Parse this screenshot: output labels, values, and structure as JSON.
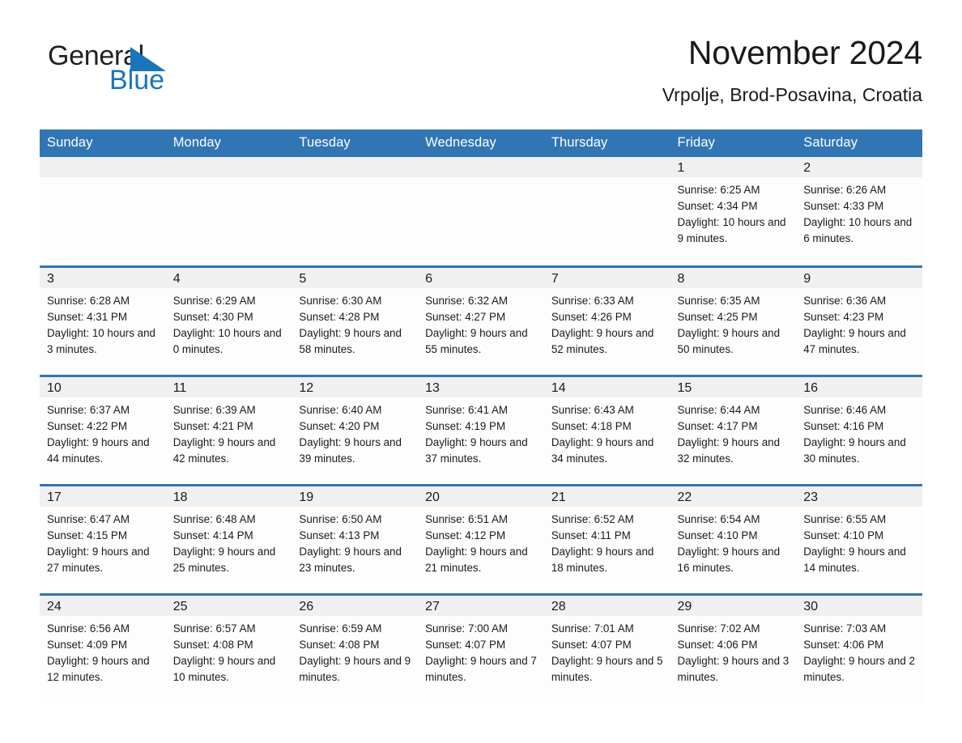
{
  "brand": {
    "line1": "General",
    "line2": "Blue",
    "triangle_color": "#1b75bb",
    "text_color": "#231f20"
  },
  "header": {
    "title": "November 2024",
    "subtitle": "Vrpolje, Brod-Posavina, Croatia"
  },
  "theme": {
    "header_blue": "#3275b5",
    "daynum_band": "#f0f0f0",
    "cell_bg": "#fdfdfd",
    "text": "#1a1a1a"
  },
  "labels": {
    "sunrise_prefix": "Sunrise:",
    "sunset_prefix": "Sunset:",
    "daylight_prefix": "Daylight:"
  },
  "weekday_headers": [
    "Sunday",
    "Monday",
    "Tuesday",
    "Wednesday",
    "Thursday",
    "Friday",
    "Saturday"
  ],
  "chart_data": {
    "type": "table",
    "title": "November 2024",
    "subtitle": "Vrpolje, Brod-Posavina, Croatia",
    "columns": [
      "Sunday",
      "Monday",
      "Tuesday",
      "Wednesday",
      "Thursday",
      "Friday",
      "Saturday"
    ],
    "days": [
      {
        "day": 1,
        "weekday": "Friday",
        "sunrise": "6:25 AM",
        "sunset": "4:34 PM",
        "daylight_hours": 10,
        "daylight_minutes": 9
      },
      {
        "day": 2,
        "weekday": "Saturday",
        "sunrise": "6:26 AM",
        "sunset": "4:33 PM",
        "daylight_hours": 10,
        "daylight_minutes": 6
      },
      {
        "day": 3,
        "weekday": "Sunday",
        "sunrise": "6:28 AM",
        "sunset": "4:31 PM",
        "daylight_hours": 10,
        "daylight_minutes": 3
      },
      {
        "day": 4,
        "weekday": "Monday",
        "sunrise": "6:29 AM",
        "sunset": "4:30 PM",
        "daylight_hours": 10,
        "daylight_minutes": 0
      },
      {
        "day": 5,
        "weekday": "Tuesday",
        "sunrise": "6:30 AM",
        "sunset": "4:28 PM",
        "daylight_hours": 9,
        "daylight_minutes": 58
      },
      {
        "day": 6,
        "weekday": "Wednesday",
        "sunrise": "6:32 AM",
        "sunset": "4:27 PM",
        "daylight_hours": 9,
        "daylight_minutes": 55
      },
      {
        "day": 7,
        "weekday": "Thursday",
        "sunrise": "6:33 AM",
        "sunset": "4:26 PM",
        "daylight_hours": 9,
        "daylight_minutes": 52
      },
      {
        "day": 8,
        "weekday": "Friday",
        "sunrise": "6:35 AM",
        "sunset": "4:25 PM",
        "daylight_hours": 9,
        "daylight_minutes": 50
      },
      {
        "day": 9,
        "weekday": "Saturday",
        "sunrise": "6:36 AM",
        "sunset": "4:23 PM",
        "daylight_hours": 9,
        "daylight_minutes": 47
      },
      {
        "day": 10,
        "weekday": "Sunday",
        "sunrise": "6:37 AM",
        "sunset": "4:22 PM",
        "daylight_hours": 9,
        "daylight_minutes": 44
      },
      {
        "day": 11,
        "weekday": "Monday",
        "sunrise": "6:39 AM",
        "sunset": "4:21 PM",
        "daylight_hours": 9,
        "daylight_minutes": 42
      },
      {
        "day": 12,
        "weekday": "Tuesday",
        "sunrise": "6:40 AM",
        "sunset": "4:20 PM",
        "daylight_hours": 9,
        "daylight_minutes": 39
      },
      {
        "day": 13,
        "weekday": "Wednesday",
        "sunrise": "6:41 AM",
        "sunset": "4:19 PM",
        "daylight_hours": 9,
        "daylight_minutes": 37
      },
      {
        "day": 14,
        "weekday": "Thursday",
        "sunrise": "6:43 AM",
        "sunset": "4:18 PM",
        "daylight_hours": 9,
        "daylight_minutes": 34
      },
      {
        "day": 15,
        "weekday": "Friday",
        "sunrise": "6:44 AM",
        "sunset": "4:17 PM",
        "daylight_hours": 9,
        "daylight_minutes": 32
      },
      {
        "day": 16,
        "weekday": "Saturday",
        "sunrise": "6:46 AM",
        "sunset": "4:16 PM",
        "daylight_hours": 9,
        "daylight_minutes": 30
      },
      {
        "day": 17,
        "weekday": "Sunday",
        "sunrise": "6:47 AM",
        "sunset": "4:15 PM",
        "daylight_hours": 9,
        "daylight_minutes": 27
      },
      {
        "day": 18,
        "weekday": "Monday",
        "sunrise": "6:48 AM",
        "sunset": "4:14 PM",
        "daylight_hours": 9,
        "daylight_minutes": 25
      },
      {
        "day": 19,
        "weekday": "Tuesday",
        "sunrise": "6:50 AM",
        "sunset": "4:13 PM",
        "daylight_hours": 9,
        "daylight_minutes": 23
      },
      {
        "day": 20,
        "weekday": "Wednesday",
        "sunrise": "6:51 AM",
        "sunset": "4:12 PM",
        "daylight_hours": 9,
        "daylight_minutes": 21
      },
      {
        "day": 21,
        "weekday": "Thursday",
        "sunrise": "6:52 AM",
        "sunset": "4:11 PM",
        "daylight_hours": 9,
        "daylight_minutes": 18
      },
      {
        "day": 22,
        "weekday": "Friday",
        "sunrise": "6:54 AM",
        "sunset": "4:10 PM",
        "daylight_hours": 9,
        "daylight_minutes": 16
      },
      {
        "day": 23,
        "weekday": "Saturday",
        "sunrise": "6:55 AM",
        "sunset": "4:10 PM",
        "daylight_hours": 9,
        "daylight_minutes": 14
      },
      {
        "day": 24,
        "weekday": "Sunday",
        "sunrise": "6:56 AM",
        "sunset": "4:09 PM",
        "daylight_hours": 9,
        "daylight_minutes": 12
      },
      {
        "day": 25,
        "weekday": "Monday",
        "sunrise": "6:57 AM",
        "sunset": "4:08 PM",
        "daylight_hours": 9,
        "daylight_minutes": 10
      },
      {
        "day": 26,
        "weekday": "Tuesday",
        "sunrise": "6:59 AM",
        "sunset": "4:08 PM",
        "daylight_hours": 9,
        "daylight_minutes": 9
      },
      {
        "day": 27,
        "weekday": "Wednesday",
        "sunrise": "7:00 AM",
        "sunset": "4:07 PM",
        "daylight_hours": 9,
        "daylight_minutes": 7
      },
      {
        "day": 28,
        "weekday": "Thursday",
        "sunrise": "7:01 AM",
        "sunset": "4:07 PM",
        "daylight_hours": 9,
        "daylight_minutes": 5
      },
      {
        "day": 29,
        "weekday": "Friday",
        "sunrise": "7:02 AM",
        "sunset": "4:06 PM",
        "daylight_hours": 9,
        "daylight_minutes": 3
      },
      {
        "day": 30,
        "weekday": "Saturday",
        "sunrise": "7:03 AM",
        "sunset": "4:06 PM",
        "daylight_hours": 9,
        "daylight_minutes": 2
      }
    ],
    "leading_blanks": 5,
    "weeks": 5
  }
}
